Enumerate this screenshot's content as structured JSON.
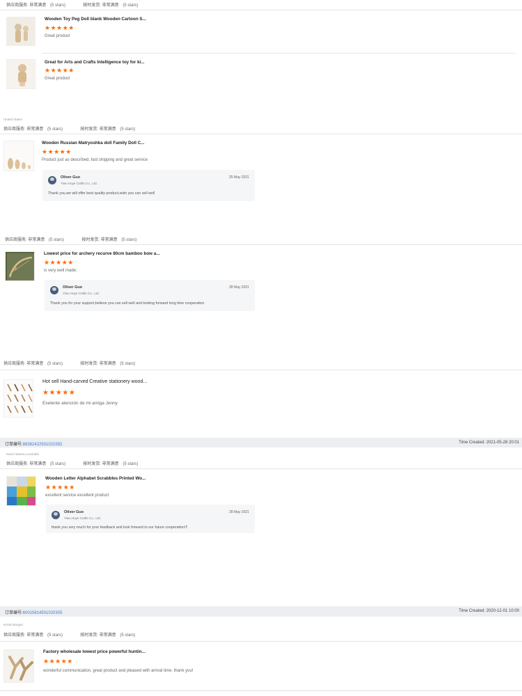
{
  "labels": {
    "supplier_service": "供应商服务:",
    "on_time_shipping": "按时发货:",
    "very_satisfied": "非常满意",
    "five_stars": "(5 stars)",
    "order_no": "订单编号:",
    "time_created": "Time Created:",
    "stars": "★★★★★"
  },
  "reviews": [
    {
      "title": "Wooden Toy Peg Doll blank Wooden Cartoon S...",
      "text": "Great product"
    },
    {
      "title": "Great for Arts and Crafts Intelligence toy for ki...",
      "text": "Great product"
    },
    {
      "title": "Wooden Russian Matryoshka doll Family Doll C...",
      "text": "Product just as described, fast shipping and great service",
      "reply": {
        "name": "Oliver Guo",
        "company": "Yiwu Hoye Crafts Co., Ltd.",
        "date": "25 May 2021",
        "text": "Thank you,we will offer best quality product,wish you can sell well"
      }
    },
    {
      "title": "Lowest price for archery recurve 80cm bamboo bow a...",
      "text": "is very well made.",
      "reply": {
        "name": "Oliver Guo",
        "company": "Yiwu Hoye Crafts Co., Ltd.",
        "date": "28 May 2021",
        "text": "Thank you for your support,believe you can sell well and looking forward long time cooperation"
      }
    },
    {
      "title": "Hot sell Hand-carved Creative stationery wood...",
      "text": "Exelente atención de mi amiga Jenny"
    },
    {
      "title": "Wooden Letter Alphabet Scrabbles Printed Wo...",
      "text": "excellent service excellent product",
      "reply": {
        "name": "Oliver Guo",
        "company": "Yiwu Hoye Crafts Co., Ltd.",
        "date": "28 May 2021",
        "text": "thank you very much for your feedback and look forward to our future cooperation!!!"
      }
    },
    {
      "title": "Factory wholesale lowest price powerful huntin...",
      "text": "wonderful communication, great product and pleased with arrival time.  thank you!"
    }
  ],
  "buyers": {
    "b1": "United States",
    "b2": "Karen Warren,Australia",
    "b3": "Krista Morgan"
  },
  "orders": [
    {
      "number": "88392422501021592",
      "time": "2021-05-28 20:01"
    },
    {
      "number": "60015814501020305",
      "time": "2020-12-01 10:00"
    }
  ],
  "colors": {
    "star": "#ff6a00",
    "link": "#3b7bd4",
    "order_bar": "#eceef1"
  }
}
